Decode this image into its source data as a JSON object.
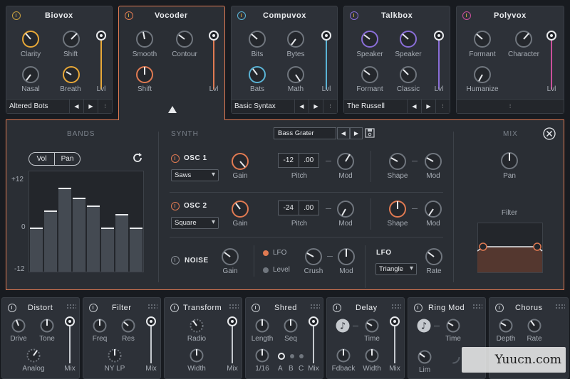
{
  "colors": {
    "accent": "#e07a52",
    "biovox": "#e8a838",
    "compuvox": "#5ab4d6",
    "talkbox": "#8a6ed8",
    "polyvox": "#c94f9b",
    "white": "#e8eaed"
  },
  "modules": [
    {
      "title": "Biovox",
      "knobs": [
        "Clarity",
        "Shift",
        "Nasal",
        "Breath"
      ],
      "level_label": "Lvl",
      "preset": "Altered Bots"
    },
    {
      "title": "Vocoder",
      "knobs": [
        "Smooth",
        "Contour",
        "Shift"
      ],
      "level_label": "Lvl",
      "preset": ""
    },
    {
      "title": "Compuvox",
      "knobs": [
        "Bits",
        "Bytes",
        "Bats",
        "Math"
      ],
      "level_label": "Lvl",
      "preset": "Basic Syntax"
    },
    {
      "title": "Talkbox",
      "knobs": [
        "Speaker",
        "Speaker",
        "Formant",
        "Classic"
      ],
      "level_label": "Lvl",
      "preset": "The Russell"
    },
    {
      "title": "Polyvox",
      "knobs": [
        "Formant",
        "Character",
        "Humanize"
      ],
      "level_label": "Lvl",
      "preset": ""
    }
  ],
  "bands": {
    "header": "BANDS",
    "toggle": [
      "Vol",
      "Pan"
    ],
    "scale": [
      "+12",
      "0",
      "-12"
    ],
    "levels": [
      0.0,
      0.35,
      0.82,
      0.62,
      0.45,
      0.0,
      0.28,
      0.0
    ]
  },
  "synth": {
    "header": "SYNTH",
    "preset": "Bass Grater",
    "osc1": {
      "label": "OSC 1",
      "wave": "Saws",
      "gain": "Gain",
      "pitch": [
        "-12",
        ".00"
      ],
      "pitch_label": "Pitch",
      "mod": "Mod",
      "shape": "Shape",
      "mod2": "Mod"
    },
    "osc2": {
      "label": "OSC 2",
      "wave": "Square",
      "gain": "Gain",
      "pitch": [
        "-24",
        ".00"
      ],
      "pitch_label": "Pitch",
      "mod": "Mod",
      "shape": "Shape",
      "mod2": "Mod"
    },
    "noise": {
      "label": "NOISE",
      "gain": "Gain",
      "lfo_opt": "LFO",
      "level_opt": "Level",
      "crush": "Crush",
      "mod": "Mod"
    },
    "lfo": {
      "label": "LFO",
      "wave": "Triangle",
      "rate": "Rate"
    }
  },
  "mix": {
    "header": "MIX",
    "pan": "Pan",
    "filter": "Filter"
  },
  "effects": [
    {
      "title": "Distort",
      "labels": [
        "Drive",
        "Tone",
        "Analog",
        "Mix"
      ]
    },
    {
      "title": "Filter",
      "labels": [
        "Freq",
        "Res",
        "NY LP",
        "Mix"
      ]
    },
    {
      "title": "Transform",
      "labels": [
        "Radio",
        "Width",
        "Mix"
      ]
    },
    {
      "title": "Shred",
      "labels": [
        "Length",
        "Seq",
        "1/16",
        "A",
        "B",
        "C",
        "Mix"
      ]
    },
    {
      "title": "Delay",
      "labels": [
        "Time",
        "Fdback",
        "Width",
        "Mix"
      ]
    },
    {
      "title": "Ring Mod",
      "labels": [
        "Time",
        "Lim"
      ]
    },
    {
      "title": "Chorus",
      "labels": [
        "Depth",
        "Rate"
      ]
    }
  ],
  "watermark": "Yuucn.com"
}
